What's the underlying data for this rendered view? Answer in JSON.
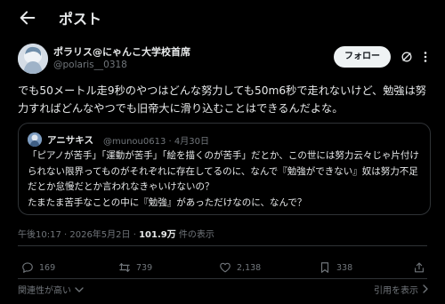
{
  "header": {
    "title": "ポスト"
  },
  "author": {
    "name": "ポラリス@にゃんこ大学校首席",
    "handle": "@polaris__0318",
    "follow_label": "フォロー"
  },
  "post": {
    "text": "でも50メートル走9秒のやつはどんな努力しても50m6秒で走れないけど、勉強は努力すればどんなやつでも旧帝大に滑り込むことはできるんだよな。",
    "timestamp": "午後10:17 · 2026年5月2日 · ",
    "views_count": "101.9万",
    "views_suffix": " 件の表示"
  },
  "quote": {
    "name": "アニサキス",
    "meta": "@munou0613 · 4月30日",
    "text": "「ピアノが苦手」「運動が苦手」「絵を描くのが苦手」だとか、この世には努力云々じゃ片付けられない限界ってものがそれぞれに存在してるのに、なんで『勉強ができない』奴は努力不足だとか怠慢だとか言われなきゃいけないの？\nたまたま苦手なことの中に『勉強』があっただけなのに、なんで？"
  },
  "actions": {
    "replies": "169",
    "reposts": "739",
    "likes": "2,138",
    "bookmarks": "338"
  },
  "footer": {
    "sort_label": "関連性が高い",
    "quotes_label": "引用を表示"
  },
  "icons": {
    "back": "arrow-left-icon",
    "grok": "grok-icon",
    "more": "more-icon",
    "reply": "reply-icon",
    "repost": "repost-icon",
    "like": "heart-icon",
    "bookmark": "bookmark-icon",
    "share": "share-icon"
  }
}
